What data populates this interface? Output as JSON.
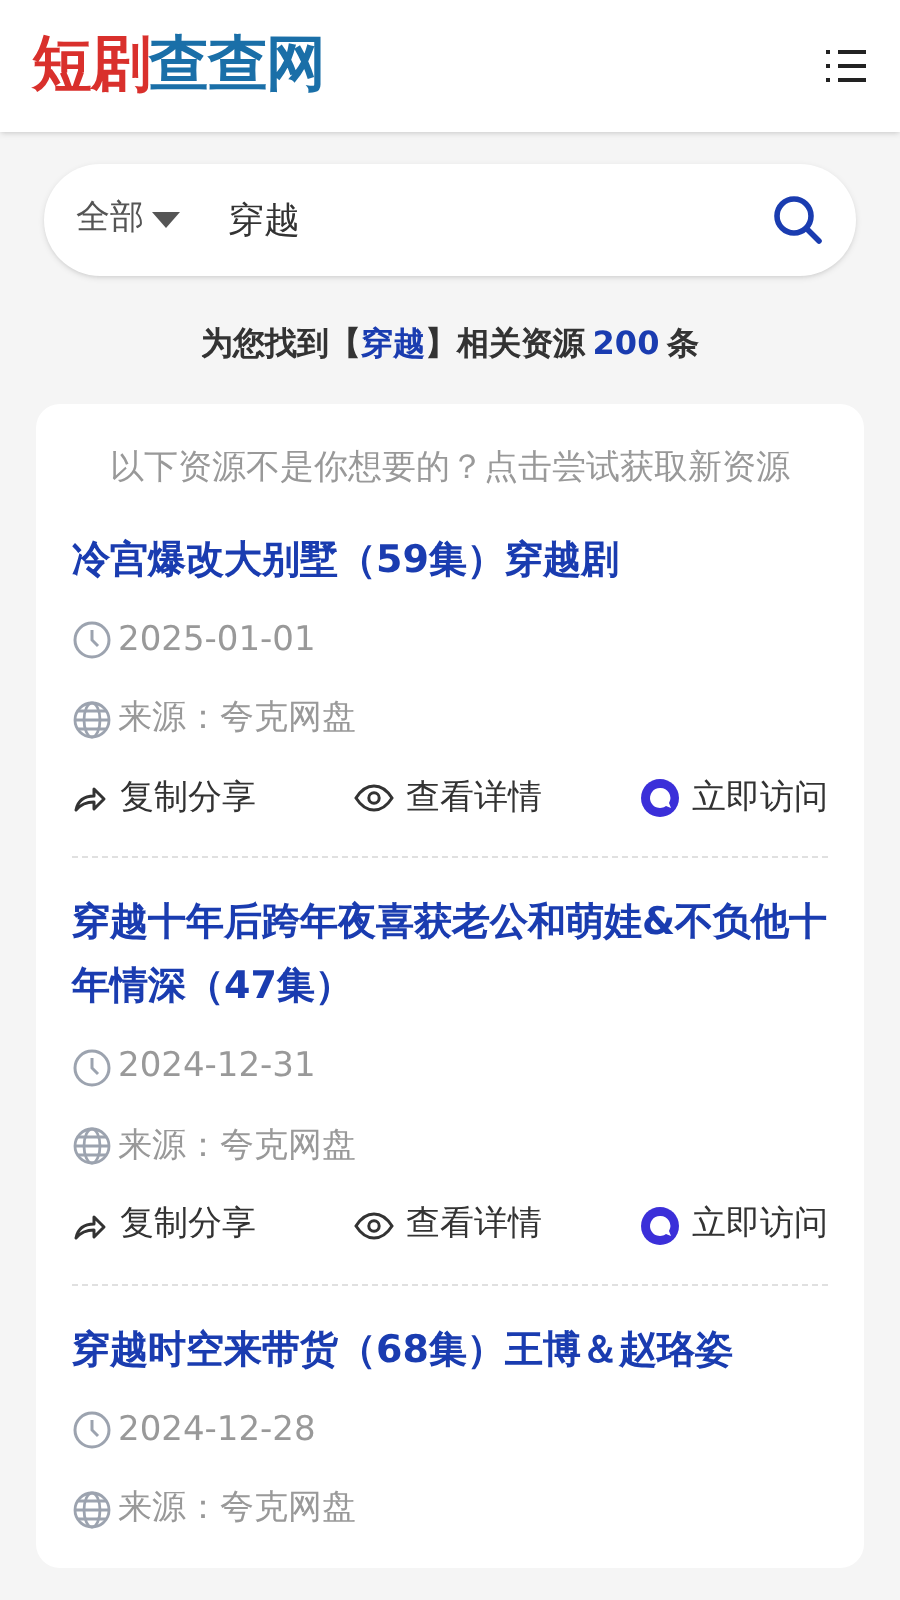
{
  "header": {
    "logo": {
      "part_1": "短剧",
      "part_2": "查查网"
    }
  },
  "search": {
    "category": "全部",
    "value": "穿越"
  },
  "result_summary": {
    "prefix": "为您找到【",
    "keyword": "穿越",
    "middle": "】相关资源",
    "count": "200",
    "suffix": "条"
  },
  "notice": "以下资源不是你想要的？点击尝试获取新资源",
  "results": [
    {
      "title": "冷宫爆改大别墅（59集）穿越剧",
      "date": "2025-01-01",
      "source": "来源：夸克网盘",
      "actions": [
        "复制分享",
        "查看详情",
        "立即访问"
      ]
    },
    {
      "title": "穿越十年后跨年夜喜获老公和萌娃&不负他十年情深（47集）",
      "date": "2024-12-31",
      "source": "来源：夸克网盘",
      "actions": [
        "复制分享",
        "查看详情",
        "立即访问"
      ]
    },
    {
      "title": "穿越时空来带货（68集）王博＆赵珞姿",
      "date": "2024-12-28",
      "source": "来源：夸克网盘"
    }
  ]
}
